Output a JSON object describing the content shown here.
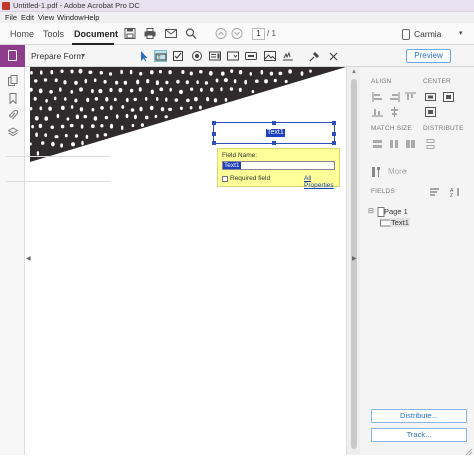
{
  "window": {
    "title": "Untitled-1.pdf - Adobe Acrobat Pro DC"
  },
  "menu": [
    "File",
    "Edit",
    "View",
    "Window",
    "Help"
  ],
  "tabs": [
    {
      "label": "Home"
    },
    {
      "label": "Tools"
    },
    {
      "label": "Document",
      "active": true
    }
  ],
  "page_nav": {
    "current": "1",
    "total": "/ 1"
  },
  "user": {
    "name": "Carmia"
  },
  "formbar": {
    "title": "Prepare Form",
    "preview_label": "Preview",
    "accent_color": "#8e3d8c"
  },
  "form_field": {
    "name": "Text1",
    "popup_label": "Field Name:",
    "value": "Text1",
    "required_label": "Required field",
    "all_properties_label": "All Properties"
  },
  "right_panel": {
    "align_label": "ALIGN",
    "center_label": "CENTER",
    "match_size_label": "MATCH SIZE",
    "distribute_label": "DISTRIBUTE",
    "more_label": "More",
    "fields_label": "FIELDS",
    "tree": {
      "page_label": "Page 1",
      "field_label": "Text1"
    },
    "distribute_button": "Distribute...",
    "track_button": "Track..."
  }
}
